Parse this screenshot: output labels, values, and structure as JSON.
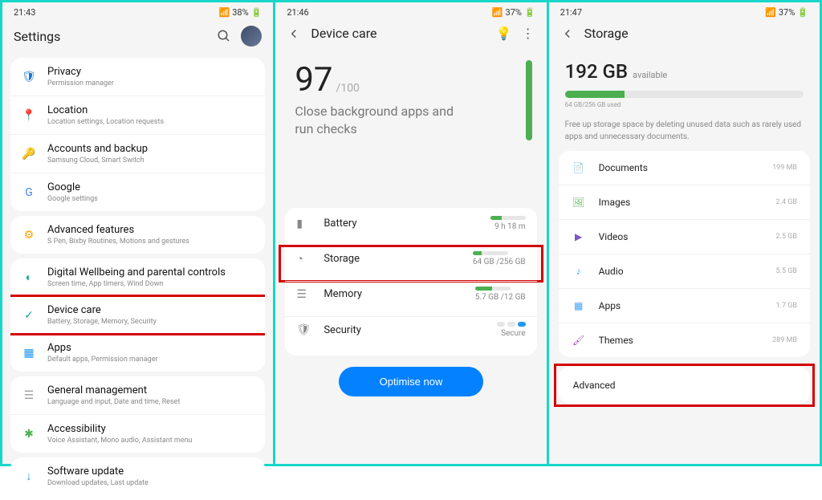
{
  "screen1": {
    "status": {
      "time": "21:43",
      "battery": "38%"
    },
    "title": "Settings",
    "items": [
      {
        "icon": "privacy",
        "color": "#1976d2",
        "title": "Privacy",
        "sub": "Permission manager"
      },
      {
        "icon": "location",
        "color": "#4caf50",
        "title": "Location",
        "sub": "Location settings, Location requests"
      },
      {
        "icon": "accounts",
        "color": "#1976d2",
        "title": "Accounts and backup",
        "sub": "Samsung Cloud, Smart Switch"
      },
      {
        "icon": "google",
        "color": "#4285F4",
        "title": "Google",
        "sub": "Google settings"
      },
      {
        "icon": "advanced",
        "color": "#ffa000",
        "title": "Advanced features",
        "sub": "S Pen, Bixby Routines, Motions and gestures"
      },
      {
        "icon": "wellbeing",
        "color": "#26a69a",
        "title": "Digital Wellbeing and parental controls",
        "sub": "Screen time, App timers, Wind Down"
      },
      {
        "icon": "devicecare",
        "color": "#26a69a",
        "title": "Device care",
        "sub": "Battery, Storage, Memory, Security",
        "highlight": true
      },
      {
        "icon": "apps",
        "color": "#2196f3",
        "title": "Apps",
        "sub": "Default apps, Permission manager"
      },
      {
        "icon": "general",
        "color": "#9e9e9e",
        "title": "General management",
        "sub": "Language and input, Date and time, Reset"
      },
      {
        "icon": "accessibility",
        "color": "#4caf50",
        "title": "Accessibility",
        "sub": "Voice Assistant, Mono audio, Assistant menu"
      },
      {
        "icon": "softupdate",
        "color": "#2196f3",
        "title": "Software update",
        "sub": "Download updates, Last update"
      }
    ]
  },
  "screen2": {
    "status": {
      "time": "21:46",
      "battery": "37%"
    },
    "title": "Device care",
    "score": "97",
    "score_max": "/100",
    "score_sub": "Close background apps and run checks",
    "stats": [
      {
        "label": "Battery",
        "value": "9 h 18 m",
        "fill": 32
      },
      {
        "label": "Storage",
        "value": "64 GB /256 GB",
        "fill": 25,
        "highlight": true
      },
      {
        "label": "Memory",
        "value": "5.7 GB /12 GB",
        "fill": 48
      },
      {
        "label": "Security",
        "value": "Secure",
        "toggle": true
      }
    ],
    "optimise": "Optimise now"
  },
  "screen3": {
    "status": {
      "time": "21:47",
      "battery": "37%"
    },
    "title": "Storage",
    "gb": "192 GB",
    "avail": "available",
    "used_caption": "64 GB/256 GB used",
    "desc": "Free up storage space by deleting unused data such as rarely used apps and unnecessary documents.",
    "rows": [
      {
        "icon": "documents",
        "color": "#ffa726",
        "name": "Documents",
        "size": "199 MB"
      },
      {
        "icon": "images",
        "color": "#66bb6a",
        "name": "Images",
        "size": "2.4 GB"
      },
      {
        "icon": "videos",
        "color": "#7e57c2",
        "name": "Videos",
        "size": "2.5 GB"
      },
      {
        "icon": "audio",
        "color": "#29b6f6",
        "name": "Audio",
        "size": "5.5 GB"
      },
      {
        "icon": "apps",
        "color": "#42a5f5",
        "name": "Apps",
        "size": "1.7 GB"
      },
      {
        "icon": "themes",
        "color": "#ab47bc",
        "name": "Themes",
        "size": "289 MB"
      }
    ],
    "advanced": "Advanced"
  }
}
